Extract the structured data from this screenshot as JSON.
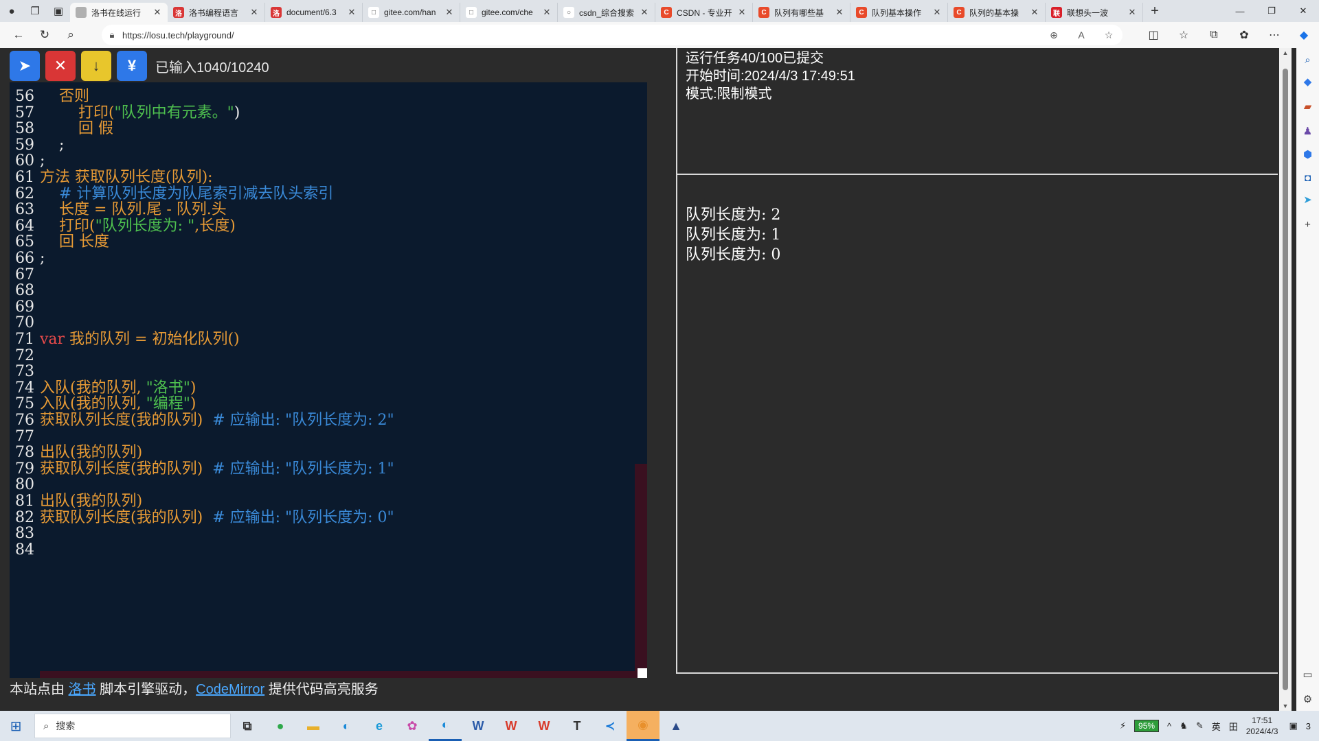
{
  "browser": {
    "tabs": [
      {
        "label": "洛书在线运行",
        "fav_color": "#b0b0b0",
        "fav_glyph": "",
        "active": true
      },
      {
        "label": "洛书编程语言",
        "fav_color": "#d93636",
        "fav_glyph": "洛",
        "active": false
      },
      {
        "label": "document/6.3",
        "fav_color": "#d93636",
        "fav_glyph": "洛",
        "active": false
      },
      {
        "label": "gitee.com/han",
        "fav_color": "#ffffff",
        "fav_glyph": "□",
        "active": false
      },
      {
        "label": "gitee.com/che",
        "fav_color": "#ffffff",
        "fav_glyph": "□",
        "active": false
      },
      {
        "label": "csdn_综合搜索",
        "fav_color": "#ffffff",
        "fav_glyph": "○",
        "active": false
      },
      {
        "label": "CSDN - 专业开",
        "fav_color": "#e84a2a",
        "fav_glyph": "C",
        "active": false
      },
      {
        "label": "队列有哪些基",
        "fav_color": "#e84a2a",
        "fav_glyph": "C",
        "active": false
      },
      {
        "label": "队列基本操作",
        "fav_color": "#e84a2a",
        "fav_glyph": "C",
        "active": false
      },
      {
        "label": "队列的基本操",
        "fav_color": "#e84a2a",
        "fav_glyph": "C",
        "active": false
      },
      {
        "label": "联想头一波",
        "fav_color": "#d9202a",
        "fav_glyph": "联",
        "active": false
      }
    ],
    "url": "https://losu.tech/playground/"
  },
  "controls": {
    "run_icon": "run-icon",
    "stop_icon": "stop-icon",
    "download_icon": "download-icon",
    "format_icon": "format-icon",
    "input_count": "已输入1040/10240"
  },
  "editor": {
    "lines": [
      {
        "n": "56",
        "tokens": [
          {
            "t": "    否则",
            "c": "c-kw"
          }
        ]
      },
      {
        "n": "57",
        "tokens": [
          {
            "t": "        打印(",
            "c": "c-id"
          },
          {
            "t": "\"队列中有元素。\"",
            "c": "c-str"
          },
          {
            "t": ")",
            "c": "c-op"
          }
        ]
      },
      {
        "n": "58",
        "tokens": [
          {
            "t": "        回 假",
            "c": "c-kw"
          }
        ]
      },
      {
        "n": "59",
        "tokens": [
          {
            "t": "    ;",
            "c": "c-op"
          }
        ]
      },
      {
        "n": "60",
        "tokens": [
          {
            "t": ";",
            "c": "c-op"
          }
        ]
      },
      {
        "n": "61",
        "tokens": [
          {
            "t": "方法 获取队列长度(队列):",
            "c": "c-kw"
          }
        ]
      },
      {
        "n": "62",
        "tokens": [
          {
            "t": "    # 计算队列长度为队尾索引减去队头索引",
            "c": "c-cm"
          }
        ]
      },
      {
        "n": "63",
        "tokens": [
          {
            "t": "    长度 = 队列.尾 - 队列.头",
            "c": "c-id"
          }
        ]
      },
      {
        "n": "64",
        "tokens": [
          {
            "t": "    打印(",
            "c": "c-id"
          },
          {
            "t": "\"队列长度为: \"",
            "c": "c-str"
          },
          {
            "t": ",长度)",
            "c": "c-id"
          }
        ]
      },
      {
        "n": "65",
        "tokens": [
          {
            "t": "    回 长度",
            "c": "c-kw"
          }
        ]
      },
      {
        "n": "66",
        "tokens": [
          {
            "t": ";",
            "c": "c-op"
          }
        ]
      },
      {
        "n": "67",
        "tokens": []
      },
      {
        "n": "68",
        "tokens": []
      },
      {
        "n": "69",
        "tokens": []
      },
      {
        "n": "70",
        "tokens": []
      },
      {
        "n": "71",
        "tokens": [
          {
            "t": "var",
            "c": "c-var"
          },
          {
            "t": " 我的队列 = 初始化队列()",
            "c": "c-id"
          }
        ]
      },
      {
        "n": "72",
        "tokens": []
      },
      {
        "n": "73",
        "tokens": []
      },
      {
        "n": "74",
        "tokens": [
          {
            "t": "入队(我的队列, ",
            "c": "c-id"
          },
          {
            "t": "\"洛书\"",
            "c": "c-str"
          },
          {
            "t": ")",
            "c": "c-id"
          }
        ]
      },
      {
        "n": "75",
        "tokens": [
          {
            "t": "入队(我的队列, ",
            "c": "c-id"
          },
          {
            "t": "\"编程\"",
            "c": "c-str"
          },
          {
            "t": ")",
            "c": "c-id"
          }
        ]
      },
      {
        "n": "76",
        "tokens": [
          {
            "t": "获取队列长度(我的队列)  ",
            "c": "c-id"
          },
          {
            "t": "# 应输出: \"队列长度为: 2\"",
            "c": "c-cm"
          }
        ]
      },
      {
        "n": "77",
        "tokens": []
      },
      {
        "n": "78",
        "tokens": [
          {
            "t": "出队(我的队列)",
            "c": "c-id"
          }
        ]
      },
      {
        "n": "79",
        "tokens": [
          {
            "t": "获取队列长度(我的队列)  ",
            "c": "c-id"
          },
          {
            "t": "# 应输出: \"队列长度为: 1\"",
            "c": "c-cm"
          }
        ]
      },
      {
        "n": "80",
        "tokens": []
      },
      {
        "n": "81",
        "tokens": [
          {
            "t": "出队(我的队列)",
            "c": "c-id"
          }
        ]
      },
      {
        "n": "82",
        "tokens": [
          {
            "t": "获取队列长度(我的队列)  ",
            "c": "c-id"
          },
          {
            "t": "# 应输出: \"队列长度为: 0\"",
            "c": "c-cm"
          }
        ]
      },
      {
        "n": "83",
        "tokens": []
      },
      {
        "n": "84",
        "tokens": []
      }
    ]
  },
  "footer": {
    "prefix": "本站点由 ",
    "link1": "洛书",
    "middle": " 脚本引擎驱动，",
    "link2": "CodeMirror",
    "suffix": " 提供代码高亮服务"
  },
  "status": {
    "task": "运行任务40/100已提交",
    "start_time": "开始时间:2024/4/3 17:49:51",
    "mode": "模式:限制模式"
  },
  "output": {
    "lines": [
      "队列长度为: 2",
      "队列长度为: 1",
      "队列长度为: 0"
    ]
  },
  "taskbar": {
    "search_placeholder": "搜索",
    "battery": "95%",
    "ime": "英",
    "time": "17:51",
    "date": "2024/4/3",
    "notifications": "3"
  }
}
